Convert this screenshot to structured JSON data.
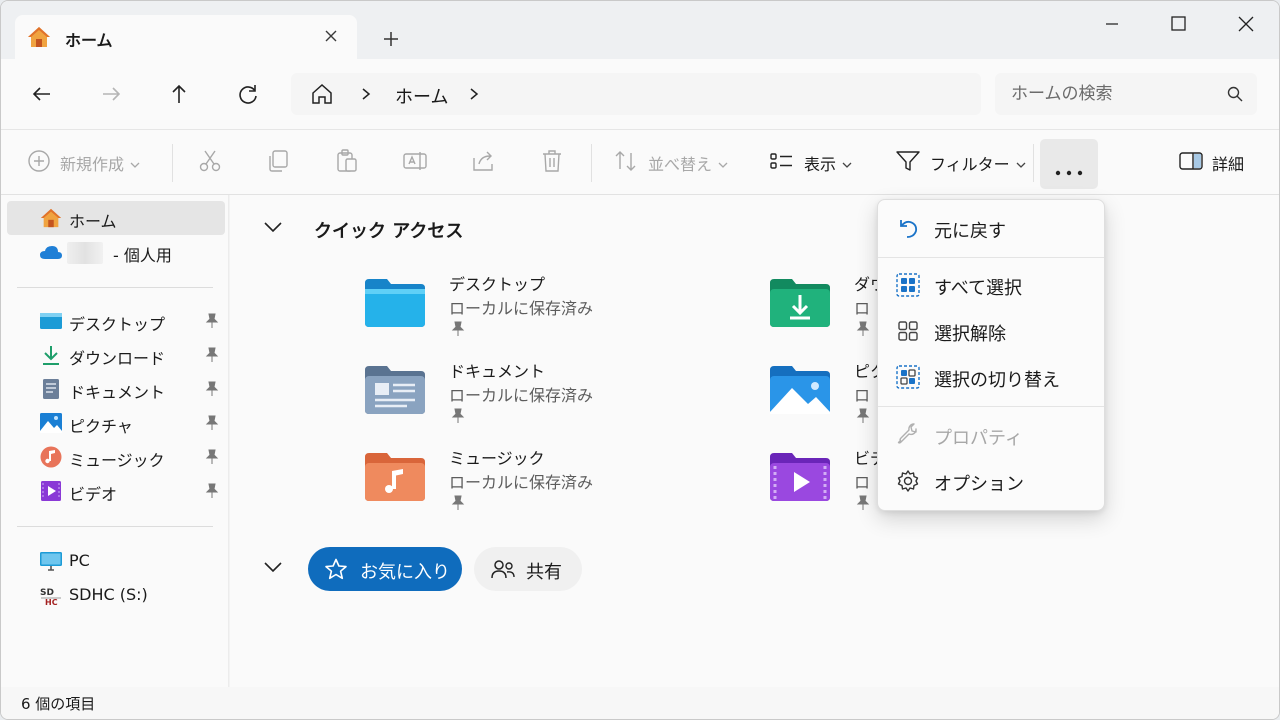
{
  "window": {
    "tab_title": "ホーム",
    "new_tab_symbol": "+",
    "controls": [
      "minimize",
      "maximize",
      "close"
    ]
  },
  "address": {
    "breadcrumb": [
      "ホーム"
    ],
    "search_placeholder": "ホームの検索"
  },
  "toolbar": {
    "new_label": "新規作成",
    "sort_label": "並べ替え",
    "view_label": "表示",
    "filter_label": "フィルター",
    "more_label": "...",
    "details_label": "詳細",
    "icons": [
      "cut-icon",
      "copy-icon",
      "paste-icon",
      "rename-icon",
      "share-icon",
      "delete-icon"
    ]
  },
  "sidebar": {
    "home": "ホーム",
    "onedrive_suffix": "- 個人用",
    "pinned": [
      {
        "label": "デスクトップ",
        "icon": "desktop-icon"
      },
      {
        "label": "ダウンロード",
        "icon": "download-icon"
      },
      {
        "label": "ドキュメント",
        "icon": "document-icon"
      },
      {
        "label": "ピクチャ",
        "icon": "pictures-icon"
      },
      {
        "label": "ミュージック",
        "icon": "music-icon"
      },
      {
        "label": "ビデオ",
        "icon": "video-icon"
      }
    ],
    "devices": [
      {
        "label": "PC",
        "icon": "pc-icon"
      },
      {
        "label": "SDHC (S:)",
        "icon": "sd-card-icon"
      }
    ]
  },
  "main": {
    "quick_access_title": "クイック アクセス",
    "items": [
      {
        "name": "デスクトップ",
        "sub": "ローカルに保存済み",
        "icon": "desktop-folder-icon"
      },
      {
        "name": "ドキュメント",
        "sub": "ローカルに保存済み",
        "icon": "documents-folder-icon"
      },
      {
        "name": "ミュージック",
        "sub": "ローカルに保存済み",
        "icon": "music-folder-icon"
      },
      {
        "name": "ダウ",
        "sub": "ロ",
        "icon": "downloads-folder-icon"
      },
      {
        "name": "ピク",
        "sub": "ロ",
        "icon": "pictures-folder-icon"
      },
      {
        "name": "ビデ",
        "sub": "ロ",
        "icon": "videos-folder-icon"
      }
    ],
    "favorites_label": "お気に入り",
    "shared_label": "共有"
  },
  "status": {
    "item_count": "6 個の項目"
  },
  "menu": {
    "items": [
      {
        "label": "元に戻す",
        "icon": "undo-icon",
        "enabled": true
      },
      {
        "label": "すべて選択",
        "icon": "select-all-icon",
        "enabled": true
      },
      {
        "label": "選択解除",
        "icon": "select-none-icon",
        "enabled": true
      },
      {
        "label": "選択の切り替え",
        "icon": "invert-selection-icon",
        "enabled": true
      },
      {
        "label": "プロパティ",
        "icon": "wrench-icon",
        "enabled": false
      },
      {
        "label": "オプション",
        "icon": "settings-icon",
        "enabled": true
      }
    ]
  },
  "colors": {
    "accent": "#0f6cbd",
    "selected_item": "#e5e5e5"
  }
}
